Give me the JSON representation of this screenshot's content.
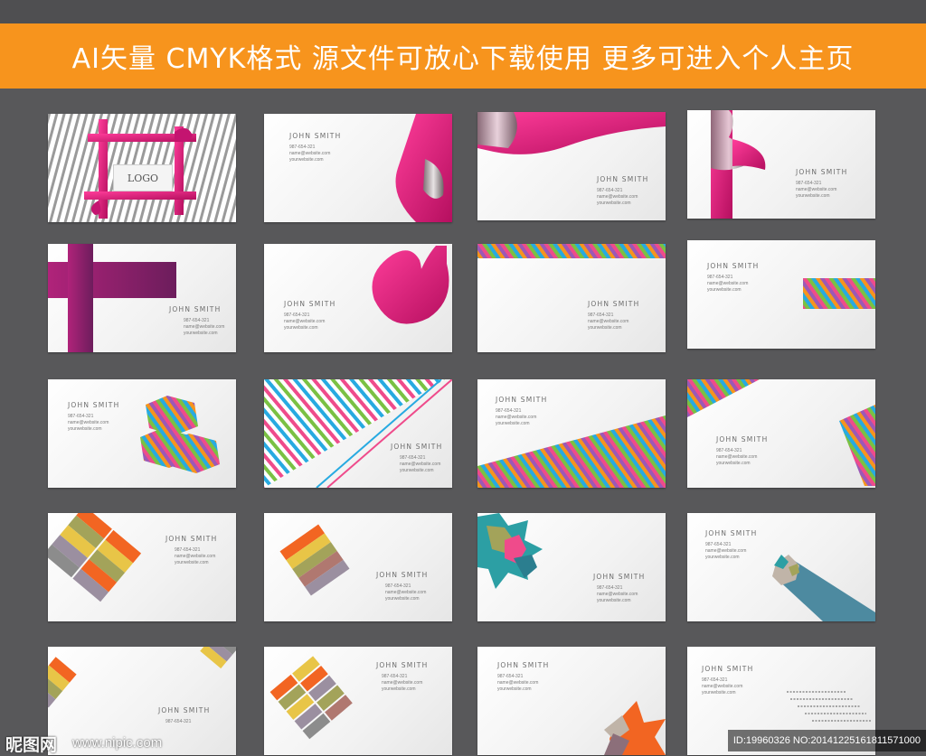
{
  "banner": {
    "text": "AI矢量  CMYK格式  源文件可放心下载使用  更多可进入个人主页"
  },
  "card": {
    "name": "JOHN SMITH",
    "phone": "987-654-321",
    "email": "name@website.com",
    "web": "yourwebsite.com",
    "logo": "LOGO"
  },
  "watermark": {
    "site_logo": "昵图网",
    "site_url": "www.nipic.com",
    "id_text": "ID:19960326 NO:20141225161811571000"
  },
  "colors": {
    "banner": "#f7941d",
    "background": "#58585a",
    "magenta": "#e0157a",
    "purple": "#8b1e6e",
    "stripes": [
      "#ef4b8b",
      "#7ac143",
      "#27aae1",
      "#f7941d",
      "#9b59b6"
    ],
    "blocks": [
      "#f26522",
      "#a3a35a",
      "#9b8fa0",
      "#8c8c8c",
      "#e8c547"
    ]
  }
}
